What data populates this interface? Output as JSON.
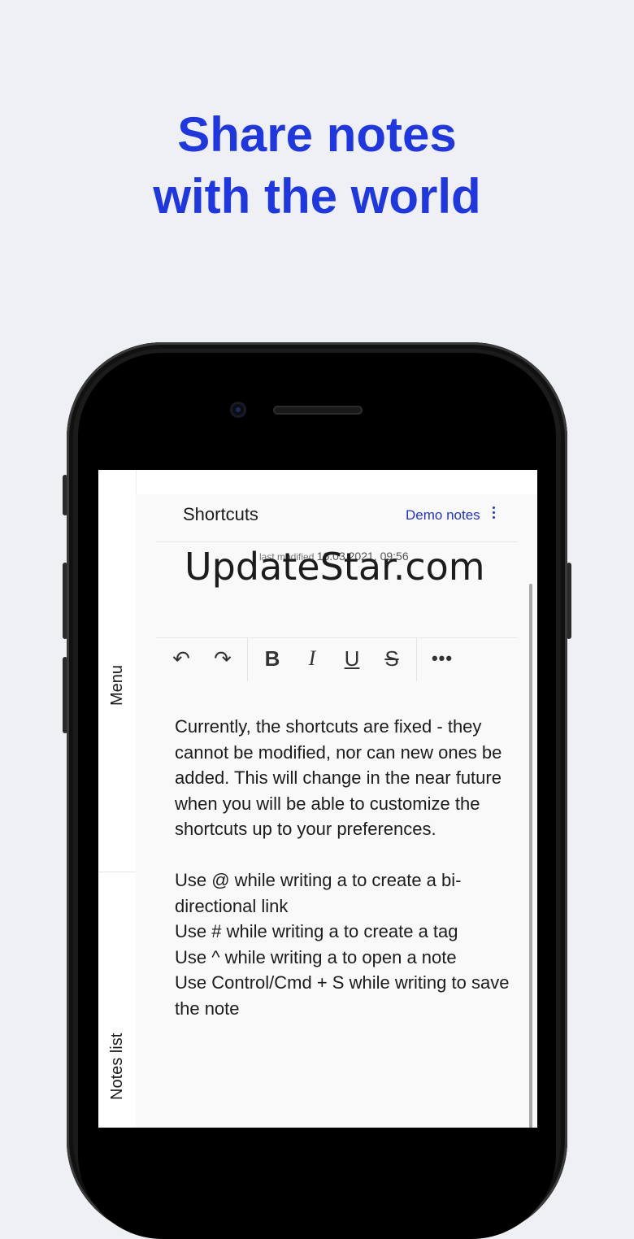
{
  "headline": {
    "line1": "Share notes",
    "line2": "with the world"
  },
  "rail": {
    "menu_label": "Menu",
    "notes_list_label": "Notes list"
  },
  "note": {
    "title": "Shortcuts",
    "folder": "Demo notes",
    "meta_label": "last modified",
    "meta_date": "16.03.2021, 09:56"
  },
  "watermark": "UpdateStar.com",
  "toolbar": {
    "undo_icon": "↶",
    "redo_icon": "↷",
    "bold": "B",
    "italic": "I",
    "underline": "U",
    "strike": "S",
    "more": "•••"
  },
  "body": {
    "para1": "Currently, the shortcuts are fixed - they cannot be modified, nor can new ones be added. This will change in the near future when you will be able to customize the shortcuts up to your preferences.",
    "line1": "Use @ while writing a to create a bi-directional link",
    "line2": "Use # while writing a to create a tag",
    "line3": "Use ^ while writing a to open a note",
    "line4": "Use Control/Cmd + S while writing to save the note"
  }
}
